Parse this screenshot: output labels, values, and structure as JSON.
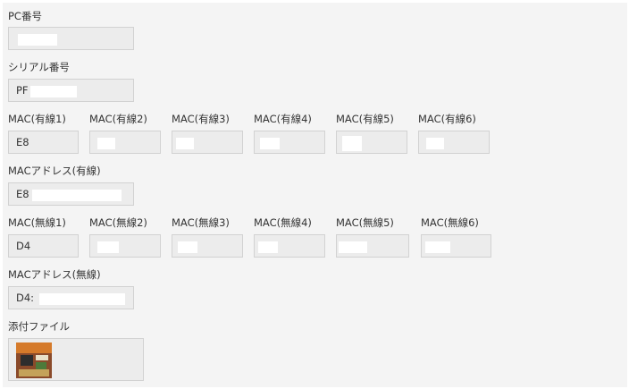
{
  "fields": {
    "pc_number": {
      "label": "PC番号",
      "value": ""
    },
    "serial_number": {
      "label": "シリアル番号",
      "value": "PF"
    },
    "mac_wired": [
      {
        "label": "MAC(有線1)",
        "value": "E8"
      },
      {
        "label": "MAC(有線2)",
        "value": ""
      },
      {
        "label": "MAC(有線3)",
        "value": ""
      },
      {
        "label": "MAC(有線4)",
        "value": ""
      },
      {
        "label": "MAC(有線5)",
        "value": ""
      },
      {
        "label": "MAC(有線6)",
        "value": ""
      }
    ],
    "mac_address_wired": {
      "label": "MACアドレス(有線)",
      "value": "E8"
    },
    "mac_wireless": [
      {
        "label": "MAC(無線1)",
        "value": "D4"
      },
      {
        "label": "MAC(無線2)",
        "value": ""
      },
      {
        "label": "MAC(無線3)",
        "value": ""
      },
      {
        "label": "MAC(無線4)",
        "value": ""
      },
      {
        "label": "MAC(無線5)",
        "value": ""
      },
      {
        "label": "MAC(無線6)",
        "value": ""
      }
    ],
    "mac_address_wireless": {
      "label": "MACアドレス(無線)",
      "value": "D4:"
    },
    "attachment": {
      "label": "添付ファイル"
    }
  }
}
